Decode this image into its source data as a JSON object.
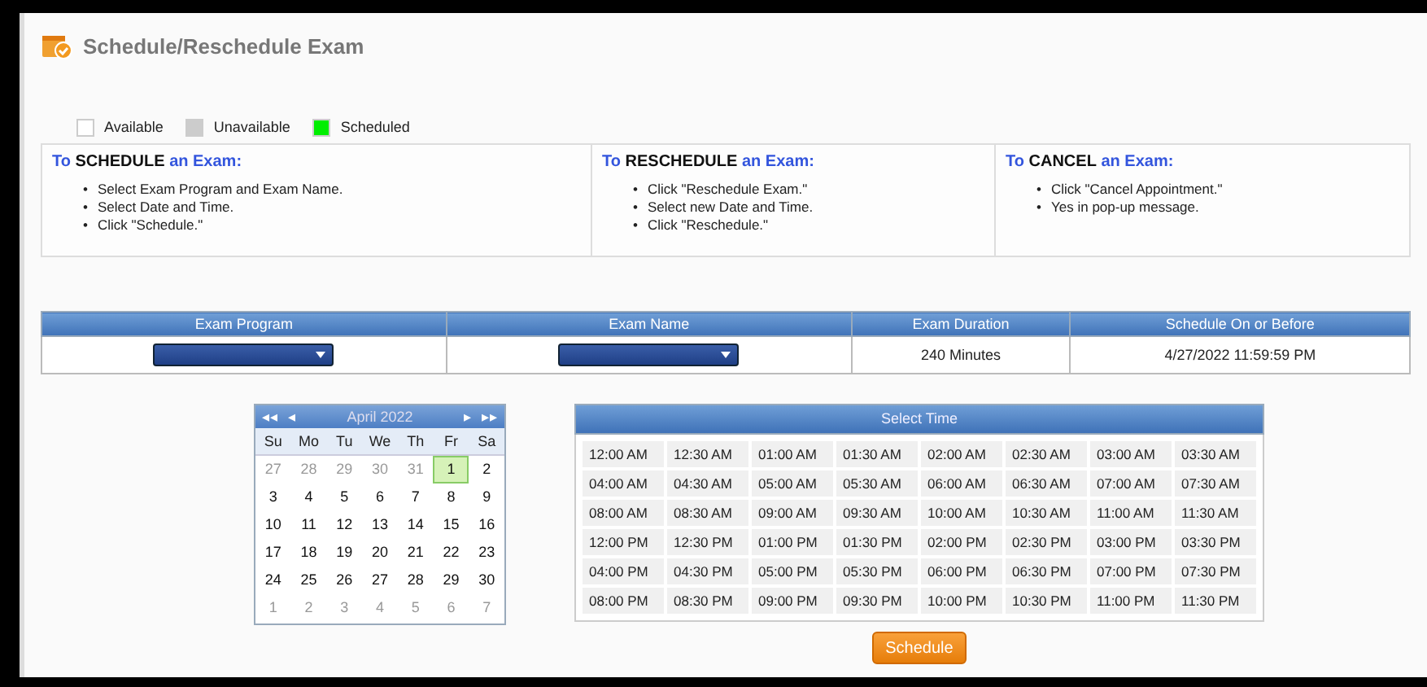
{
  "page": {
    "title": "Schedule/Reschedule Exam"
  },
  "legend": [
    {
      "label": "Available",
      "color": "#ffffff"
    },
    {
      "label": "Unavailable",
      "color": "#cccccc"
    },
    {
      "label": "Scheduled",
      "color": "#00ee00"
    }
  ],
  "instructions_bullet": "•",
  "instructions": [
    {
      "prefix": "To",
      "action": "SCHEDULE",
      "suffix": "an Exam:",
      "steps": [
        "Select Exam Program and Exam Name.",
        "Select Date and Time.",
        "Click \"Schedule.\""
      ]
    },
    {
      "prefix": "To",
      "action": "RESCHEDULE",
      "suffix": "an Exam:",
      "steps": [
        "Click \"Reschedule Exam.\"",
        "Select new Date and Time.",
        "Click \"Reschedule.\""
      ]
    },
    {
      "prefix": "To",
      "action": "CANCEL",
      "suffix": "an Exam:",
      "steps": [
        "Click \"Cancel Appointment.\"",
        "Yes in pop-up message."
      ]
    }
  ],
  "exam_table": {
    "columns": [
      "Exam Program",
      "Exam Name",
      "Exam Duration",
      "Schedule On or Before"
    ],
    "cells": [
      {
        "kind": "dropdown"
      },
      {
        "kind": "dropdown"
      },
      {
        "kind": "text",
        "text": "240 Minutes"
      },
      {
        "kind": "text",
        "text": "4/27/2022 11:59:59 PM"
      }
    ]
  },
  "calendar": {
    "nav": [
      "◂◂",
      "◂",
      "▸",
      "▸▸"
    ],
    "month": "April 2022",
    "weekdays": [
      "Su",
      "Mo",
      "Tu",
      "We",
      "Th",
      "Fr",
      "Sa"
    ],
    "days": [
      {
        "day": "27",
        "muted": true,
        "selected": false
      },
      {
        "day": "28",
        "muted": true,
        "selected": false
      },
      {
        "day": "29",
        "muted": true,
        "selected": false
      },
      {
        "day": "30",
        "muted": true,
        "selected": false
      },
      {
        "day": "31",
        "muted": true,
        "selected": false
      },
      {
        "day": "1",
        "muted": false,
        "selected": true
      },
      {
        "day": "2",
        "muted": false,
        "selected": false
      },
      {
        "day": "3",
        "muted": false,
        "selected": false
      },
      {
        "day": "4",
        "muted": false,
        "selected": false
      },
      {
        "day": "5",
        "muted": false,
        "selected": false
      },
      {
        "day": "6",
        "muted": false,
        "selected": false
      },
      {
        "day": "7",
        "muted": false,
        "selected": false
      },
      {
        "day": "8",
        "muted": false,
        "selected": false
      },
      {
        "day": "9",
        "muted": false,
        "selected": false
      },
      {
        "day": "10",
        "muted": false,
        "selected": false
      },
      {
        "day": "11",
        "muted": false,
        "selected": false
      },
      {
        "day": "12",
        "muted": false,
        "selected": false
      },
      {
        "day": "13",
        "muted": false,
        "selected": false
      },
      {
        "day": "14",
        "muted": false,
        "selected": false
      },
      {
        "day": "15",
        "muted": false,
        "selected": false
      },
      {
        "day": "16",
        "muted": false,
        "selected": false
      },
      {
        "day": "17",
        "muted": false,
        "selected": false
      },
      {
        "day": "18",
        "muted": false,
        "selected": false
      },
      {
        "day": "19",
        "muted": false,
        "selected": false
      },
      {
        "day": "20",
        "muted": false,
        "selected": false
      },
      {
        "day": "21",
        "muted": false,
        "selected": false
      },
      {
        "day": "22",
        "muted": false,
        "selected": false
      },
      {
        "day": "23",
        "muted": false,
        "selected": false
      },
      {
        "day": "24",
        "muted": false,
        "selected": false
      },
      {
        "day": "25",
        "muted": false,
        "selected": false
      },
      {
        "day": "26",
        "muted": false,
        "selected": false
      },
      {
        "day": "27",
        "muted": false,
        "selected": false
      },
      {
        "day": "28",
        "muted": false,
        "selected": false
      },
      {
        "day": "29",
        "muted": false,
        "selected": false
      },
      {
        "day": "30",
        "muted": false,
        "selected": false
      },
      {
        "day": "1",
        "muted": true,
        "selected": false
      },
      {
        "day": "2",
        "muted": true,
        "selected": false
      },
      {
        "day": "3",
        "muted": true,
        "selected": false
      },
      {
        "day": "4",
        "muted": true,
        "selected": false
      },
      {
        "day": "5",
        "muted": true,
        "selected": false
      },
      {
        "day": "6",
        "muted": true,
        "selected": false
      },
      {
        "day": "7",
        "muted": true,
        "selected": false
      }
    ]
  },
  "time_picker": {
    "title": "Select Time",
    "slots": [
      "12:00 AM",
      "12:30 AM",
      "01:00 AM",
      "01:30 AM",
      "02:00 AM",
      "02:30 AM",
      "03:00 AM",
      "03:30 AM",
      "04:00 AM",
      "04:30 AM",
      "05:00 AM",
      "05:30 AM",
      "06:00 AM",
      "06:30 AM",
      "07:00 AM",
      "07:30 AM",
      "08:00 AM",
      "08:30 AM",
      "09:00 AM",
      "09:30 AM",
      "10:00 AM",
      "10:30 AM",
      "11:00 AM",
      "11:30 AM",
      "12:00 PM",
      "12:30 PM",
      "01:00 PM",
      "01:30 PM",
      "02:00 PM",
      "02:30 PM",
      "03:00 PM",
      "03:30 PM",
      "04:00 PM",
      "04:30 PM",
      "05:00 PM",
      "05:30 PM",
      "06:00 PM",
      "06:30 PM",
      "07:00 PM",
      "07:30 PM",
      "08:00 PM",
      "08:30 PM",
      "09:00 PM",
      "09:30 PM",
      "10:00 PM",
      "10:30 PM",
      "11:00 PM",
      "11:30 PM"
    ]
  },
  "schedule_button": "Schedule"
}
